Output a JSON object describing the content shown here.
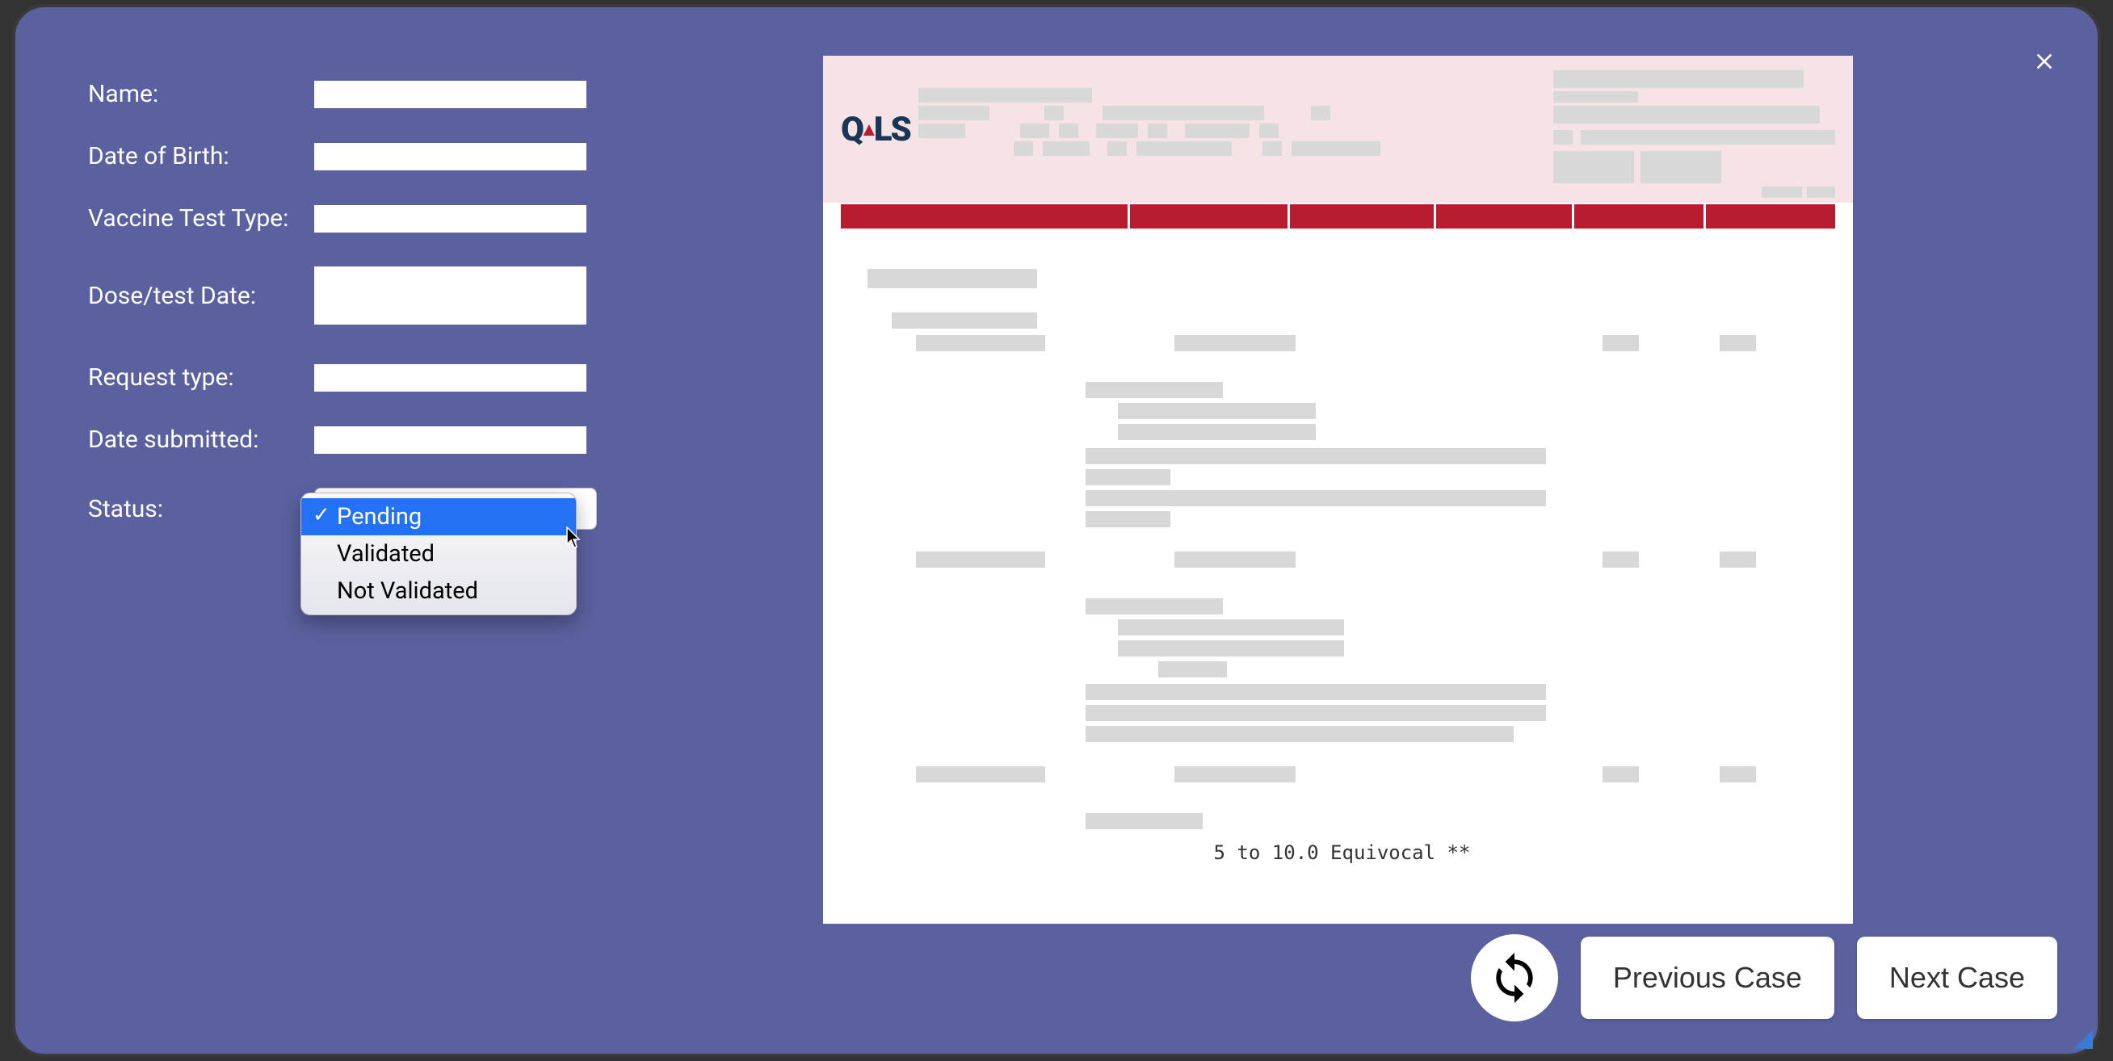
{
  "form": {
    "name_label": "Name:",
    "name_value": "",
    "dob_label": "Date of Birth:",
    "dob_value": "",
    "vaccine_type_label": "Vaccine Test Type:",
    "vaccine_type_value": "",
    "dose_date_label": "Dose/test Date:",
    "dose_date_value": "",
    "request_type_label": "Request type:",
    "request_type_value": "",
    "date_submitted_label": "Date submitted:",
    "date_submitted_value": "",
    "status_label": "Status:",
    "status_selected": "Pending",
    "status_options": [
      "Pending",
      "Validated",
      "Not Validated"
    ]
  },
  "document": {
    "logo_text": "QLS",
    "footer_text": "5 to 10.0 Equivocal **"
  },
  "buttons": {
    "previous": "Previous Case",
    "next": "Next Case"
  },
  "icons": {
    "close": "close-icon",
    "refresh": "refresh-icon"
  }
}
